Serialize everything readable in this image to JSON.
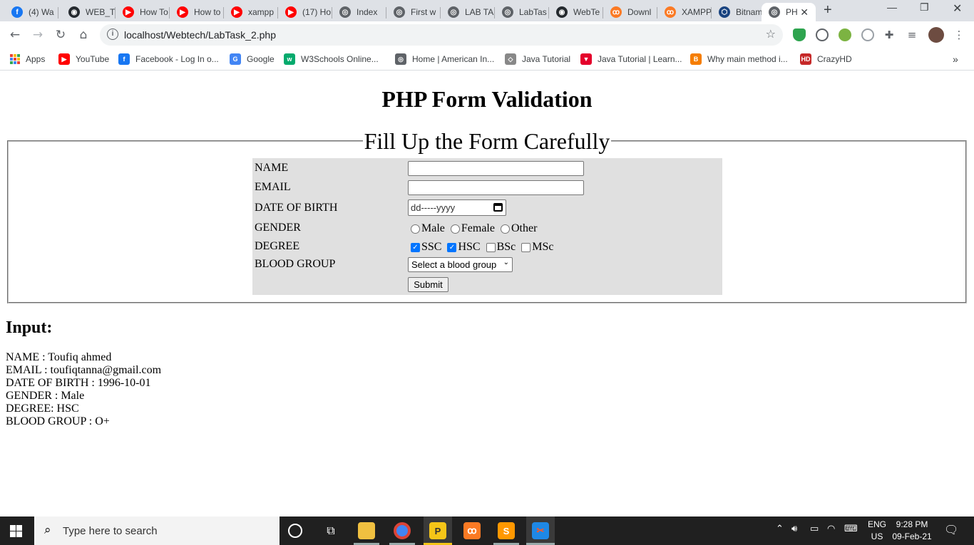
{
  "browser": {
    "tabs": [
      {
        "title": "(4) Wa",
        "fav": "facebook-icon",
        "color": "#1877f2",
        "glyph": "f"
      },
      {
        "title": "WEB_T",
        "fav": "github-icon",
        "color": "#24292e",
        "glyph": "◉"
      },
      {
        "title": "How To",
        "fav": "youtube-icon",
        "color": "#ff0000",
        "glyph": "▶"
      },
      {
        "title": "How to",
        "fav": "youtube-icon",
        "color": "#ff0000",
        "glyph": "▶"
      },
      {
        "title": "xampp",
        "fav": "youtube-icon",
        "color": "#ff0000",
        "glyph": "▶"
      },
      {
        "title": "(17) Ho",
        "fav": "youtube-icon",
        "color": "#ff0000",
        "glyph": "▶"
      },
      {
        "title": "Index",
        "fav": "globe-icon",
        "color": "#5f6368",
        "glyph": "◎"
      },
      {
        "title": "First w",
        "fav": "globe-icon",
        "color": "#5f6368",
        "glyph": "◎"
      },
      {
        "title": "LAB TA",
        "fav": "globe-icon",
        "color": "#5f6368",
        "glyph": "◎"
      },
      {
        "title": "LabTas",
        "fav": "globe-icon",
        "color": "#5f6368",
        "glyph": "◎"
      },
      {
        "title": "WebTe",
        "fav": "github-icon",
        "color": "#24292e",
        "glyph": "◉"
      },
      {
        "title": "Downl",
        "fav": "xampp-icon",
        "color": "#fb7a24",
        "glyph": "ꝏ"
      },
      {
        "title": "XAMPP",
        "fav": "xampp-icon",
        "color": "#fb7a24",
        "glyph": "ꝏ"
      },
      {
        "title": "Bitnam",
        "fav": "bitnami-icon",
        "color": "#1a4480",
        "glyph": "⬡"
      },
      {
        "title": "PH",
        "fav": "globe-icon",
        "color": "#5f6368",
        "glyph": "◎"
      }
    ],
    "url": "localhost/Webtech/LabTask_2.php",
    "bookmarks": [
      {
        "label": "Apps",
        "icon": "apps-icon"
      },
      {
        "label": "YouTube",
        "icon": "youtube-icon",
        "color": "#ff0000",
        "glyph": "▶"
      },
      {
        "label": "Facebook - Log In o...",
        "icon": "facebook-icon",
        "color": "#1877f2",
        "glyph": "f"
      },
      {
        "label": "Google",
        "icon": "google-icon",
        "color": "#4285f4",
        "glyph": "G"
      },
      {
        "label": "W3Schools Online...",
        "icon": "w3schools-icon",
        "color": "#04aa6d",
        "glyph": "w"
      },
      {
        "label": "Home | American In...",
        "icon": "globe-icon",
        "color": "#5f6368",
        "glyph": "◎"
      },
      {
        "label": "Java Tutorial",
        "icon": "java-icon",
        "color": "#888888",
        "glyph": "◇"
      },
      {
        "label": "Java Tutorial | Learn...",
        "icon": "javatpoint-icon",
        "color": "#e4002b",
        "glyph": "▼"
      },
      {
        "label": "Why main method i...",
        "icon": "blogger-icon",
        "color": "#f57d00",
        "glyph": "B"
      },
      {
        "label": "CrazyHD",
        "icon": "crazyhd-icon",
        "color": "#c62828",
        "glyph": "HD"
      }
    ]
  },
  "page": {
    "title": "PHP Form Validation",
    "legend": "Fill Up the Form Carefully",
    "form": {
      "labels": {
        "name": "NAME",
        "email": "EMAIL",
        "dob": "DATE OF BIRTH",
        "gender": "GENDER",
        "degree": "DEGREE",
        "blood": "BLOOD GROUP"
      },
      "name_value": "",
      "email_value": "",
      "dob_placeholder": "dd-----yyyy",
      "gender_options": [
        "Male",
        "Female",
        "Other"
      ],
      "degree_options": [
        {
          "label": "SSC",
          "checked": true
        },
        {
          "label": "HSC",
          "checked": true
        },
        {
          "label": "BSc",
          "checked": false
        },
        {
          "label": "MSc",
          "checked": false
        }
      ],
      "blood_selected": "Select a blood group",
      "submit_label": "Submit"
    },
    "output": {
      "heading": "Input:",
      "lines": [
        "NAME : Toufiq ahmed",
        "EMAIL : toufiqtanna@gmail.com",
        "DATE OF BIRTH : 1996-10-01",
        "GENDER : Male",
        "DEGREE: HSC",
        "BLOOD GROUP : O+"
      ]
    }
  },
  "taskbar": {
    "search_placeholder": "Type here to search",
    "lang_top": "ENG",
    "lang_bottom": "US",
    "time": "9:28 PM",
    "date": "09-Feb-21"
  }
}
